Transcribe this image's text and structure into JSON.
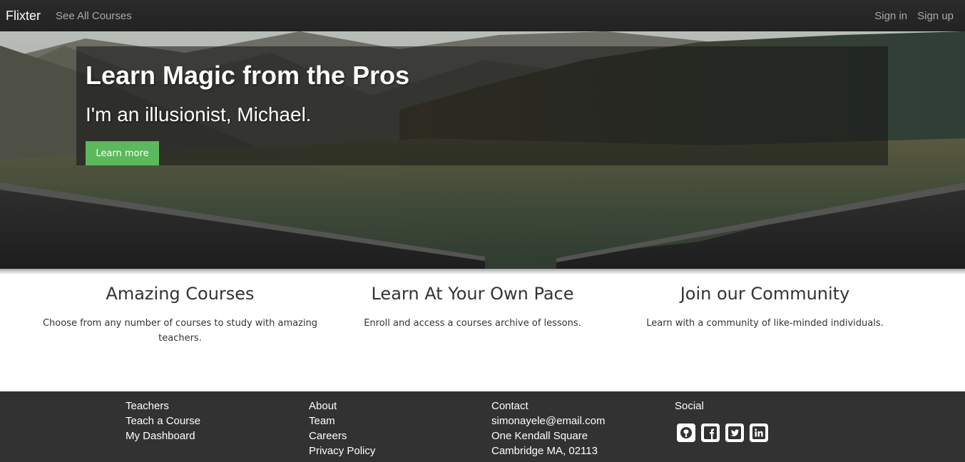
{
  "navbar": {
    "brand": "Flixter",
    "see_all": "See All Courses",
    "sign_in": "Sign in",
    "sign_up": "Sign up"
  },
  "hero": {
    "title": "Learn Magic from the Pros",
    "subtitle": "I'm an illusionist, Michael.",
    "button_label": "Learn more"
  },
  "features": [
    {
      "title": "Amazing Courses",
      "text": "Choose from any number of courses to study with amazing teachers."
    },
    {
      "title": "Learn At Your Own Pace",
      "text": "Enroll and access a courses archive of lessons."
    },
    {
      "title": "Join our Community",
      "text": "Learn with a community of like-minded individuals."
    }
  ],
  "footer": {
    "teachers": {
      "heading": "Teachers",
      "items": [
        "Teach a Course",
        "My Dashboard"
      ]
    },
    "about": {
      "heading": "About",
      "items": [
        "Team",
        "Careers",
        "Privacy Policy"
      ]
    },
    "contact": {
      "heading": "Contact",
      "items": [
        "simonayele@email.com",
        "One Kendall Square",
        "Cambridge MA, 02113"
      ]
    },
    "social": {
      "heading": "Social",
      "icons": [
        "github-icon",
        "facebook-icon",
        "twitter-icon",
        "linkedin-icon"
      ]
    }
  },
  "colors": {
    "navbar": "#252526",
    "button": "#5cb85c",
    "footer": "#323232"
  }
}
